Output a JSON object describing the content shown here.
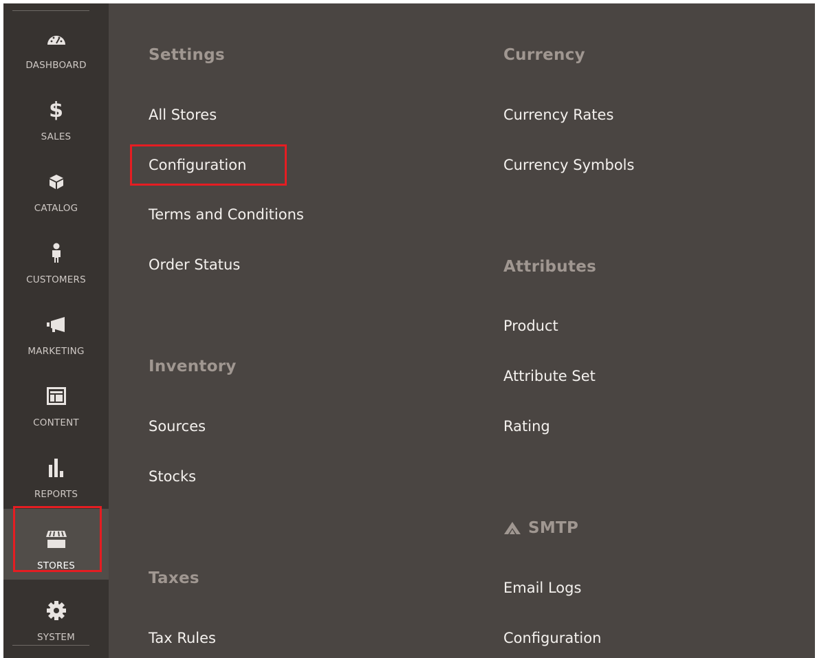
{
  "nav": [
    {
      "id": "dashboard",
      "label": "DASHBOARD",
      "icon": "dashboard-icon",
      "active": false
    },
    {
      "id": "sales",
      "label": "SALES",
      "icon": "dollar-icon",
      "active": false
    },
    {
      "id": "catalog",
      "label": "CATALOG",
      "icon": "box-icon",
      "active": false
    },
    {
      "id": "customers",
      "label": "CUSTOMERS",
      "icon": "person-icon",
      "active": false
    },
    {
      "id": "marketing",
      "label": "MARKETING",
      "icon": "megaphone-icon",
      "active": false
    },
    {
      "id": "content",
      "label": "CONTENT",
      "icon": "layout-icon",
      "active": false
    },
    {
      "id": "reports",
      "label": "REPORTS",
      "icon": "bar-chart-icon",
      "active": false
    },
    {
      "id": "stores",
      "label": "STORES",
      "icon": "storefront-icon",
      "active": true
    },
    {
      "id": "system",
      "label": "SYSTEM",
      "icon": "gear-icon",
      "active": false
    }
  ],
  "sales_symbol": "$",
  "menu": {
    "settings": {
      "title": "Settings",
      "items": [
        "All Stores",
        "Configuration",
        "Terms and Conditions",
        "Order Status"
      ]
    },
    "inventory": {
      "title": "Inventory",
      "items": [
        "Sources",
        "Stocks"
      ]
    },
    "taxes": {
      "title": "Taxes",
      "items": [
        "Tax Rules"
      ]
    },
    "currency": {
      "title": "Currency",
      "items": [
        "Currency Rates",
        "Currency Symbols"
      ]
    },
    "attributes": {
      "title": "Attributes",
      "items": [
        "Product",
        "Attribute Set",
        "Rating"
      ]
    },
    "smtp": {
      "title": "SMTP",
      "icon": "smtp-logo-icon",
      "items": [
        "Email Logs",
        "Configuration"
      ]
    }
  },
  "colors": {
    "sidebar_bg": "#373330",
    "panel_bg": "#4a4542",
    "active_bg": "#514d49",
    "heading": "#a09791",
    "link": "#f4f1ee",
    "highlight": "#e51d22"
  }
}
